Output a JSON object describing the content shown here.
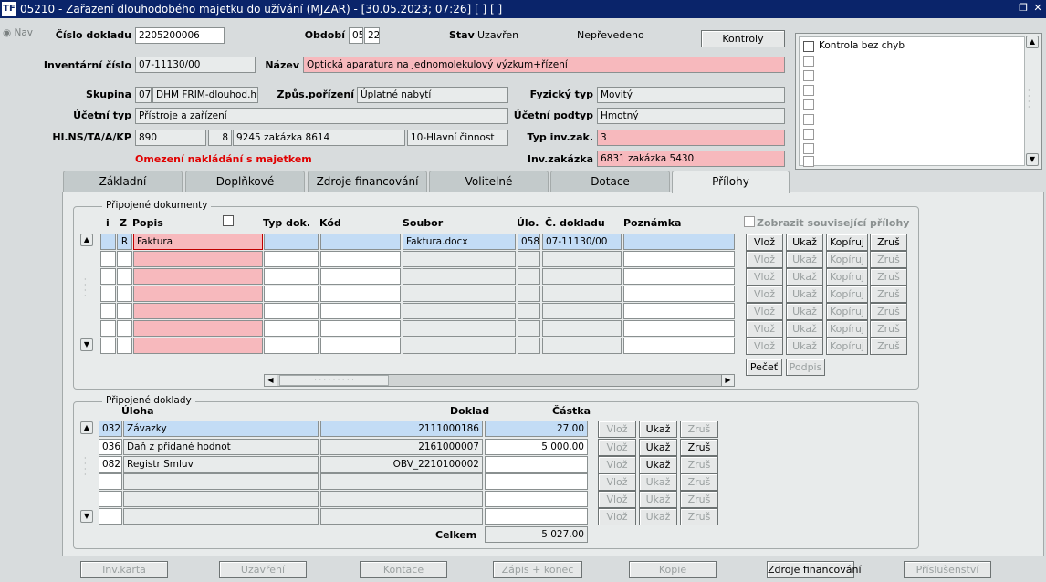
{
  "window": {
    "title": "05210 - Zařazení dlouhodobého majetku do užívání (MJZAR) - [30.05.2023; 07:26]  [ ]  [ ]",
    "logo": "TF"
  },
  "nav": {
    "label": "Nav"
  },
  "header": {
    "cislo_label": "Číslo dokladu",
    "cislo_value": "2205200006",
    "obdobi_label": "Období",
    "obdobi_month": "05",
    "obdobi_year": "22",
    "stav_label": "Stav",
    "stav_value": "Uzavřen",
    "neprevedeno": "Nepřevedeno",
    "kontroly_label": "Kontroly",
    "inv_label": "Inventární číslo",
    "inv_value": "07-11130/00",
    "nazev_label": "Název",
    "nazev_value": "Optická aparatura na jednomolekulový výzkum+řízení",
    "skupina_label": "Skupina",
    "skupina_code": "07",
    "skupina_name": "DHM FRIM-dlouhod.hmo",
    "zpusob_label": "Způs.pořízení",
    "zpusob_value": "Úplatné nabytí",
    "fyz_label": "Fyzický typ",
    "fyz_value": "Movitý",
    "ucetni_label": "Účetní typ",
    "ucetni_value": "Přístroje a zařízení",
    "podtyp_label": "Účetní podtyp",
    "podtyp_value": "Hmotný",
    "hlns_label": "Hl.NS/TA/A/KP",
    "hlns_1": "890",
    "hlns_2": "8",
    "hlns_3": "9245 zakázka 8614",
    "hlns_4": "10-Hlavní činnost",
    "typinv_label": "Typ inv.zak.",
    "typinv_value": "3",
    "omezeni": "Omezení nakládání s majetkem",
    "invzak_label": "Inv.zakázka",
    "invzak_value": "6831 zakázka 5430",
    "kontrola_bez_chyb": "Kontrola bez chyb"
  },
  "tabs": [
    "Základní",
    "Doplňkové",
    "Zdroje financování",
    "Volitelné",
    "Dotace",
    "Přílohy"
  ],
  "documents": {
    "title": "Připojené dokumenty",
    "cols": {
      "i": "i",
      "z": "Z",
      "popis": "Popis",
      "typ": "Typ dok.",
      "kod": "Kód",
      "soubor": "Soubor",
      "ulo": "Úlo.",
      "cdokladu": "Č. dokladu",
      "poznamka": "Poznámka"
    },
    "show_related": "Zobrazit související přílohy",
    "row1": {
      "z": "R",
      "popis": "Faktura",
      "soubor": "Faktura.docx",
      "ulo": "058",
      "cdokladu": "07-11130/00"
    },
    "btn_vloz": "Vlož",
    "btn_ukaz": "Ukaž",
    "btn_kopiruj": "Kopíruj",
    "btn_zrus": "Zruš",
    "btn_pecet": "Pečeť",
    "btn_podpis": "Podpis"
  },
  "doklady": {
    "title": "Připojené doklady",
    "cols": {
      "uloha": "Úloha",
      "doklad": "Doklad",
      "castka": "Částka"
    },
    "rows": [
      {
        "code": "032",
        "name": "Závazky",
        "doklad": "2111000186",
        "castka": "27.00"
      },
      {
        "code": "036",
        "name": "Daň z přidané hodnot",
        "doklad": "2161000007",
        "castka": "5 000.00"
      },
      {
        "code": "082",
        "name": "Registr Smluv",
        "doklad": "OBV_2210100002",
        "castka": ""
      }
    ],
    "celkem_label": "Celkem",
    "celkem_value": "5 027.00",
    "btn_vloz": "Vlož",
    "btn_ukaz": "Ukaž",
    "btn_zrus": "Zruš"
  },
  "footer": [
    "Inv.karta",
    "Uzavření",
    "Kontace",
    "Zápis + konec",
    "Kopie",
    "Zdroje financování",
    "Příslušenství"
  ],
  "colors": {
    "titlebar": "#0a246a",
    "pink": "#f7b9bd",
    "selected": "#c3dcf5",
    "warning_text": "#e00000"
  }
}
